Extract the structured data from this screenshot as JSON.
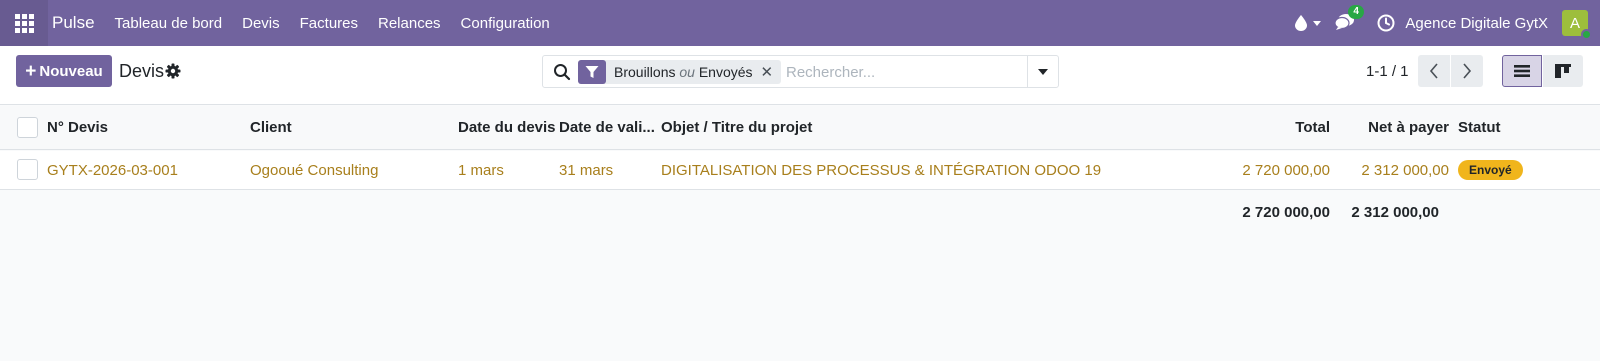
{
  "navbar": {
    "brand": "Pulse",
    "menu": [
      "Tableau de bord",
      "Devis",
      "Factures",
      "Relances",
      "Configuration"
    ],
    "messages_count": "4",
    "company": "Agence Digitale GytX",
    "avatar_letter": "A",
    "icons": [
      "apps-icon",
      "drop-icon",
      "chat-icon",
      "clock-icon"
    ]
  },
  "control": {
    "new_label": "Nouveau",
    "breadcrumb": "Devis",
    "search": {
      "facet_part1": "Brouillons",
      "facet_or": "ou",
      "facet_part2": "Envoyés",
      "placeholder": "Rechercher..."
    },
    "pager": "1-1 / 1"
  },
  "table": {
    "headers": {
      "number": "N° Devis",
      "client": "Client",
      "date": "Date du devis",
      "validity": "Date de vali...",
      "subject": "Objet / Titre du projet",
      "total": "Total",
      "net": "Net à payer",
      "status": "Statut"
    },
    "rows": [
      {
        "number": "GYTX-2026-03-001",
        "client": "Ogooué Consulting",
        "date": "1 mars",
        "validity": "31 mars",
        "subject": "DIGITALISATION DES PROCESSUS & INTÉGRATION ODOO 19",
        "total": "2 720 000,00",
        "net": "2 312 000,00",
        "status": "Envoyé"
      }
    ],
    "footer": {
      "total": "2 720 000,00",
      "net": "2 312 000,00"
    }
  },
  "colors": {
    "brand": "#71639e",
    "link": "#a87f1c",
    "status_sent": "#f0b51c"
  }
}
